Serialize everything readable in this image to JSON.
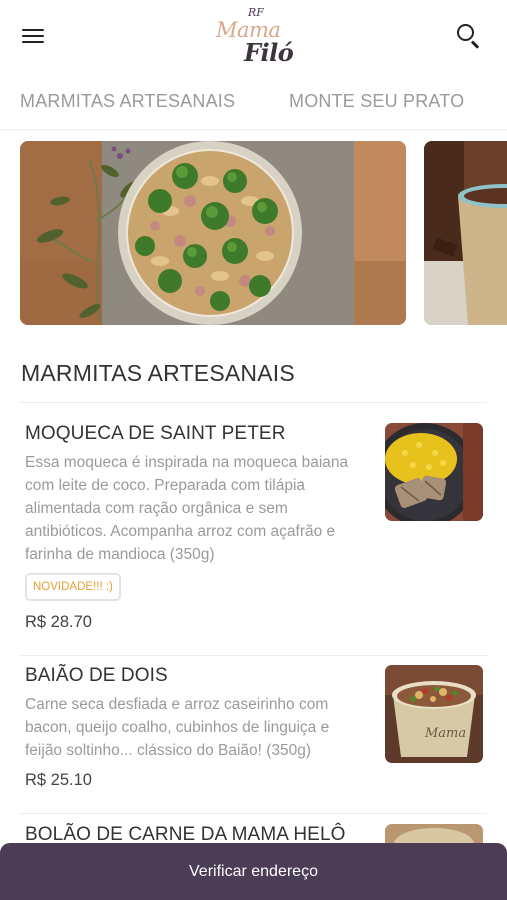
{
  "header": {
    "logo_rf": "RF",
    "logo_mama": "Mama",
    "logo_filo": "Filó"
  },
  "tabs": [
    {
      "label": "MARMITAS ARTESANAIS"
    },
    {
      "label": "MONTE SEU PRATO"
    }
  ],
  "section": {
    "title": "MARMITAS ARTESANAIS"
  },
  "products": [
    {
      "name": "MOQUECA DE SAINT PETER",
      "description": "Essa moqueca é inspirada na moqueca baiana com leite de coco. Preparada com tilápia alimentada com ração orgânica e sem antibióticos. Acompanha arroz com açafrão e farinha de mandioca (350g)",
      "badge": "NOVIDADE!!! :)",
      "price": "R$ 28.70"
    },
    {
      "name": "BAIÃO DE DOIS",
      "description": "Carne seca desfiada e arroz caseirinho com bacon, queijo coalho, cubinhos de linguiça e feijão soltinho... clássico do Baião! (350g)",
      "price": "R$ 25.10"
    },
    {
      "name": "BOLÃO DE CARNE DA MAMA HELÔ"
    }
  ],
  "bottom_bar": {
    "label": "Verificar endereço"
  },
  "colors": {
    "bottom_bar": "#4c3c55",
    "badge_text": "#e5a132",
    "logo_mama": "#d9a88a",
    "logo_filo": "#3d3440"
  }
}
